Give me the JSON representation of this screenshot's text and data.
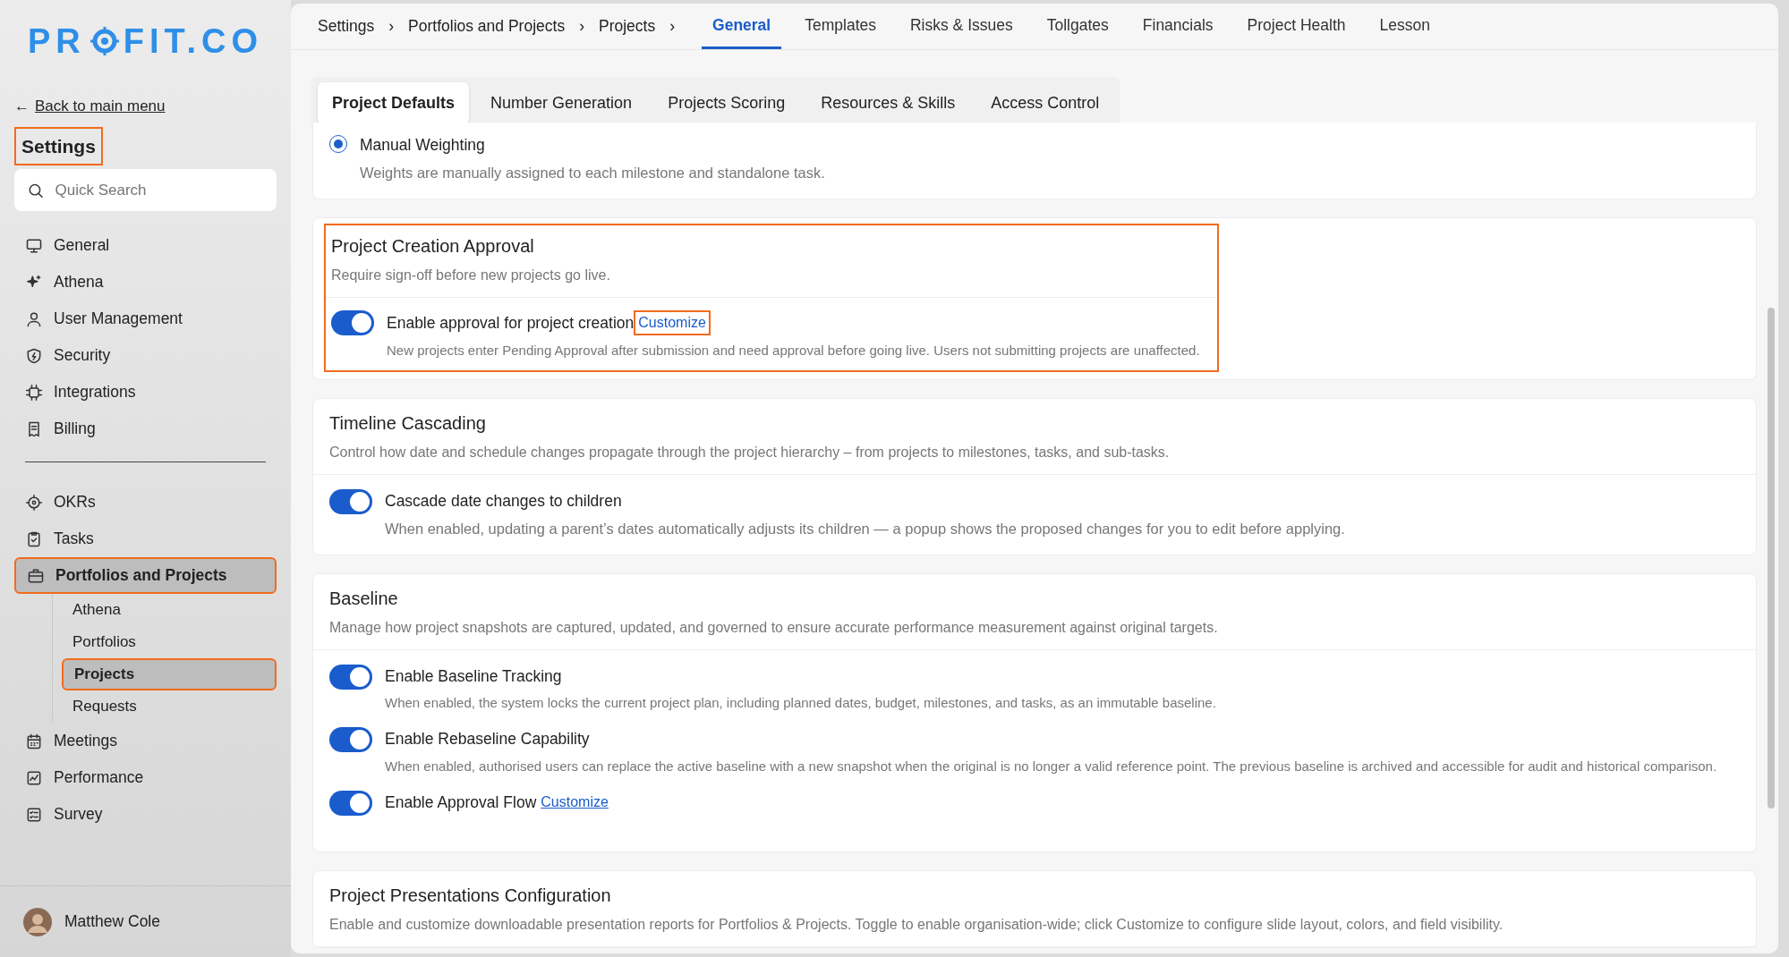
{
  "logo": {
    "before": "PR",
    "after": "FIT.CO"
  },
  "sidebar": {
    "back_link": {
      "arrow": "←",
      "text": "Back to main menu"
    },
    "title": "Settings",
    "title_highlighted": true,
    "search": {
      "placeholder": "Quick Search"
    },
    "groups": [
      [
        {
          "label": "General",
          "selected": false,
          "highlighted": false
        },
        {
          "label": "Athena",
          "selected": false,
          "highlighted": false
        },
        {
          "label": "User Management",
          "selected": false,
          "highlighted": false
        },
        {
          "label": "Security",
          "selected": false,
          "highlighted": false
        },
        {
          "label": "Integrations",
          "selected": false,
          "highlighted": false
        },
        {
          "label": "Billing",
          "selected": false,
          "highlighted": false
        }
      ],
      [
        {
          "label": "OKRs",
          "selected": false,
          "highlighted": false
        },
        {
          "label": "Tasks",
          "selected": false,
          "highlighted": false
        },
        {
          "label": "Portfolios and Projects",
          "selected": true,
          "highlighted": true,
          "children": [
            {
              "label": "Athena",
              "selected": false,
              "highlighted": false
            },
            {
              "label": "Portfolios",
              "selected": false,
              "highlighted": false
            },
            {
              "label": "Projects",
              "selected": true,
              "highlighted": true
            },
            {
              "label": "Requests",
              "selected": false,
              "highlighted": false
            }
          ]
        },
        {
          "label": "Meetings",
          "selected": false,
          "highlighted": false
        },
        {
          "label": "Performance",
          "selected": false,
          "highlighted": false
        },
        {
          "label": "Survey",
          "selected": false,
          "highlighted": false
        }
      ]
    ],
    "user": {
      "name": "Matthew Cole"
    }
  },
  "breadcrumb": [
    {
      "label": "Settings",
      "separator": "›"
    },
    {
      "label": "Portfolios and Projects",
      "separator": "›"
    },
    {
      "label": "Projects",
      "separator": "›"
    }
  ],
  "top_tabs": [
    {
      "label": "General",
      "selected": true
    },
    {
      "label": "Templates",
      "selected": false
    },
    {
      "label": "Risks & Issues",
      "selected": false
    },
    {
      "label": "Tollgates",
      "selected": false
    },
    {
      "label": "Financials",
      "selected": false
    },
    {
      "label": "Project Health",
      "selected": false
    },
    {
      "label": "Lesson",
      "selected": false
    }
  ],
  "sub_tabs": [
    {
      "label": "Project Defaults",
      "selected": true
    },
    {
      "label": "Number Generation",
      "selected": false
    },
    {
      "label": "Projects Scoring",
      "selected": false
    },
    {
      "label": "Resources & Skills",
      "selected": false
    },
    {
      "label": "Access Control",
      "selected": false
    }
  ],
  "sections": [
    {
      "highlighted": false,
      "rows": [
        {
          "kind": "radio",
          "label": "Manual Weighting",
          "checked": true,
          "description": "Weights are manually assigned to each milestone and standalone task."
        }
      ]
    },
    {
      "title": "Project Creation Approval",
      "description": "Require sign-off before new projects go live.",
      "highlighted": true,
      "rows": [
        {
          "kind": "toggle",
          "label": "Enable approval for project creation",
          "on": true,
          "link": {
            "text": "Customize",
            "highlighted": true
          },
          "description": "New projects enter Pending Approval after submission and need approval before going live. Users not submitting projects are unaffected."
        }
      ]
    },
    {
      "title": "Timeline Cascading",
      "description": "Control how date and schedule changes propagate through the project hierarchy – from projects to milestones, tasks, and sub-tasks.",
      "highlighted": false,
      "rows": [
        {
          "kind": "toggle",
          "label": "Cascade date changes to children",
          "on": true,
          "large": true,
          "description": "When enabled, updating a parent’s dates automatically adjusts its children — a popup shows the proposed changes for you to edit before applying."
        }
      ]
    },
    {
      "title": "Baseline",
      "description": "Manage how project snapshots are captured, updated, and governed to ensure accurate performance measurement against original targets.",
      "highlighted": false,
      "rows": [
        {
          "kind": "toggle",
          "label": "Enable Baseline Tracking",
          "on": true,
          "description": "When enabled, the system locks the current project plan, including planned dates, budget, milestones, and tasks, as an immutable baseline."
        },
        {
          "kind": "toggle",
          "label": "Enable Rebaseline Capability",
          "on": true,
          "description": "When enabled, authorised users can replace the active baseline with a new snapshot when the original is no longer a valid reference point. The previous baseline is archived and accessible for audit and historical comparison."
        },
        {
          "kind": "toggle",
          "label": "Enable Approval Flow",
          "on": true,
          "link": {
            "text": "Customize",
            "highlighted": false
          }
        }
      ]
    },
    {
      "title": "Project Presentations Configuration",
      "description": "Enable and customize downloadable presentation reports for Portfolios & Projects. Toggle to enable organisation-wide; click Customize to configure slide layout, colors, and field visibility.",
      "highlighted": false
    }
  ]
}
